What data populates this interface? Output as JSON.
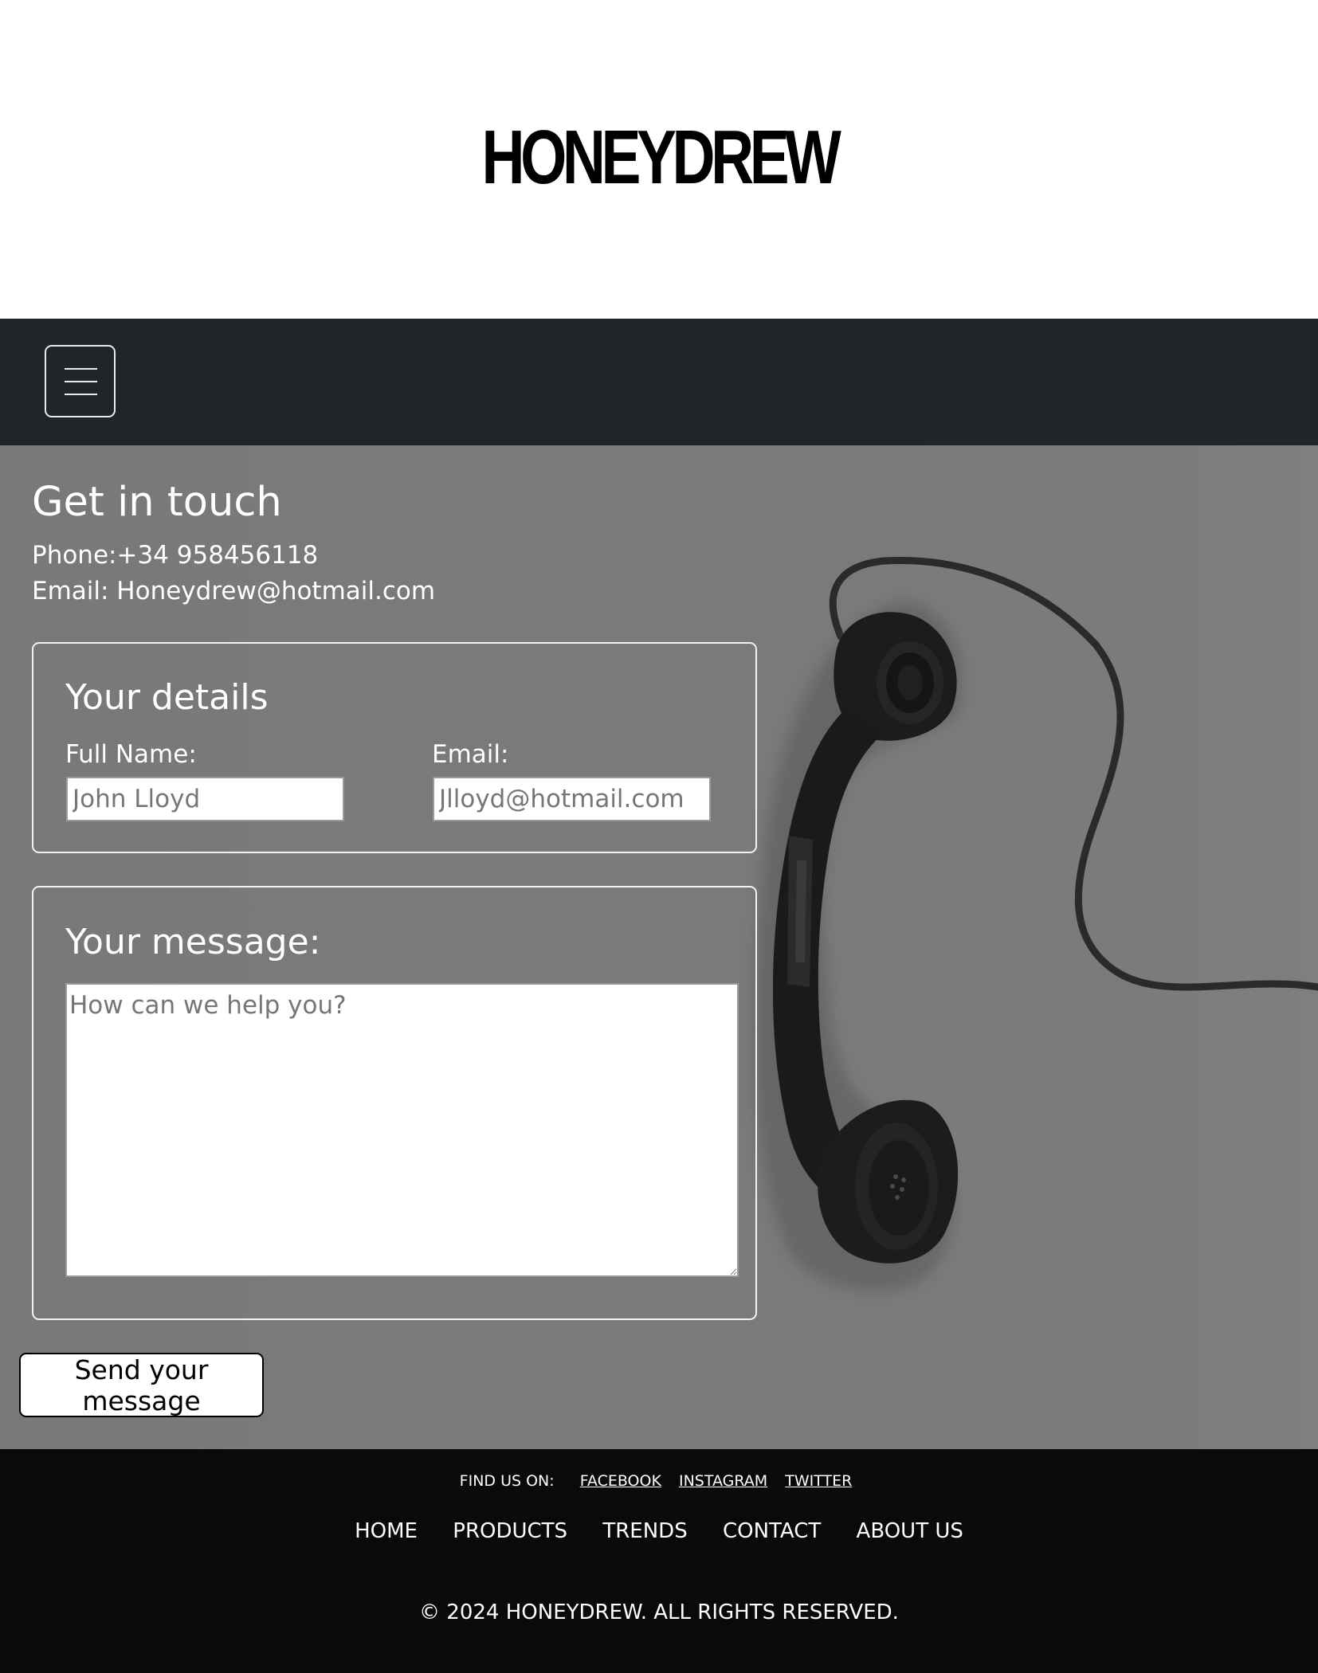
{
  "header": {
    "logo_text": "HONEYDREW"
  },
  "navbar": {
    "menu_icon": "hamburger-menu-icon"
  },
  "contact": {
    "title": "Get in touch",
    "phone_line": "Phone:+34 958456118",
    "email_line": "Email: Honeydrew@hotmail.com",
    "background_image": "black-rotary-telephone-handset-photo"
  },
  "details_form": {
    "legend": "Your details",
    "full_name_label": "Full Name:",
    "full_name_placeholder": "John Lloyd",
    "full_name_value": "",
    "email_label": "Email:",
    "email_placeholder": "Jlloyd@hotmail.com",
    "email_value": ""
  },
  "message_form": {
    "legend": "Your message:",
    "message_placeholder": "How can we help you?",
    "message_value": ""
  },
  "send_button": {
    "label": "Send your message"
  },
  "footer": {
    "find_us_label": "FIND US ON:",
    "social_links": [
      "FACEBOOK",
      "INSTAGRAM",
      "TWITTER"
    ],
    "nav_links": [
      "HOME",
      "PRODUCTS",
      "TRENDS",
      "CONTACT",
      "ABOUT US"
    ],
    "copyright": "© 2024 HONEYDREW. ALL RIGHTS RESERVED."
  },
  "colors": {
    "navbar_bg": "#212529",
    "main_bg": "#797979",
    "footer_bg": "#0a0a0a",
    "text_on_dark": "#ffffff"
  }
}
